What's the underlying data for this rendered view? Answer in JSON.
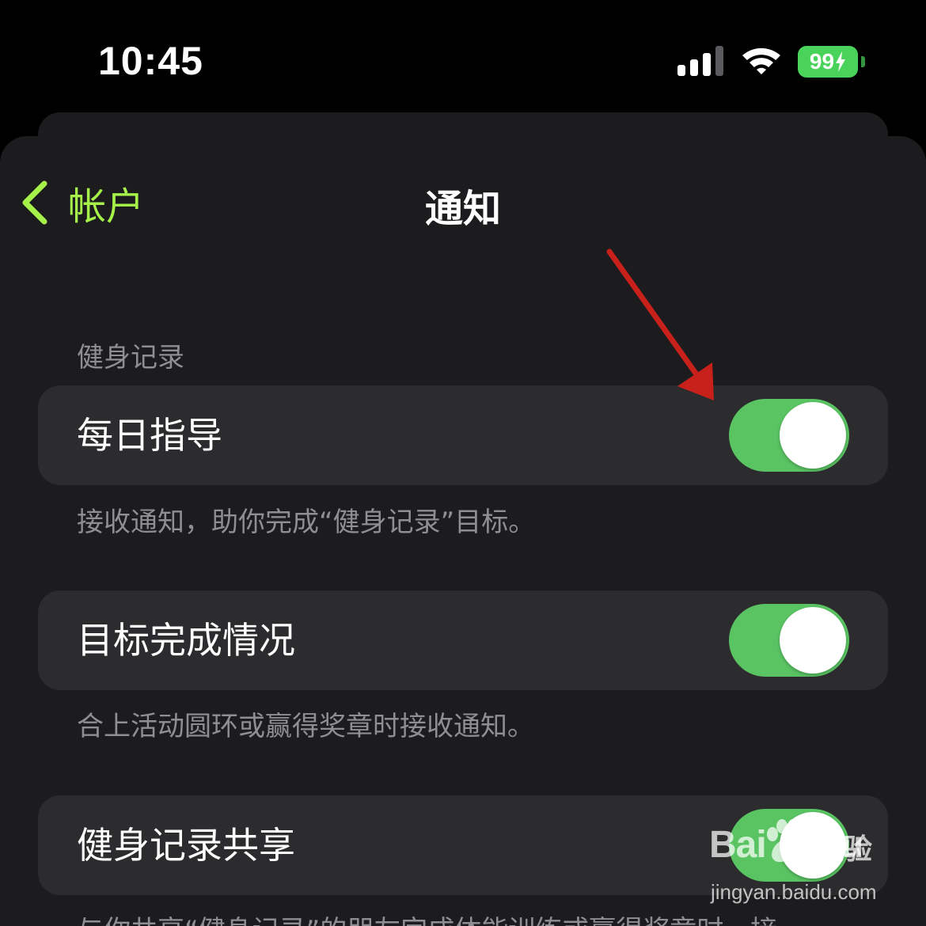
{
  "status_bar": {
    "time": "10:45",
    "battery": "99"
  },
  "nav": {
    "back_label": "帐户",
    "title": "通知"
  },
  "sections": [
    {
      "header": "健身记录",
      "label": "每日指导",
      "toggle_on": true,
      "footer": "接收通知，助你完成“健身记录”目标。"
    },
    {
      "label": "目标完成情况",
      "toggle_on": true,
      "footer": "合上活动圆环或赢得奖章时接收通知。"
    },
    {
      "label": "健身记录共享",
      "toggle_on": true,
      "footer": "与你共享“健身记录”的朋友完成体能训练或赢得奖章时，接"
    }
  ],
  "watermark": {
    "brand": "Bai",
    "brand_suffix": "du",
    "text": "经验",
    "url": "jingyan.baidu.com"
  },
  "colors": {
    "accent": "#a6f24a",
    "toggle_on": "#5ac463",
    "row_bg": "#2c2c2e",
    "sheet_bg": "#1c1c1e",
    "secondary_text": "#8e8e93",
    "annotation_arrow": "#c8201a"
  }
}
